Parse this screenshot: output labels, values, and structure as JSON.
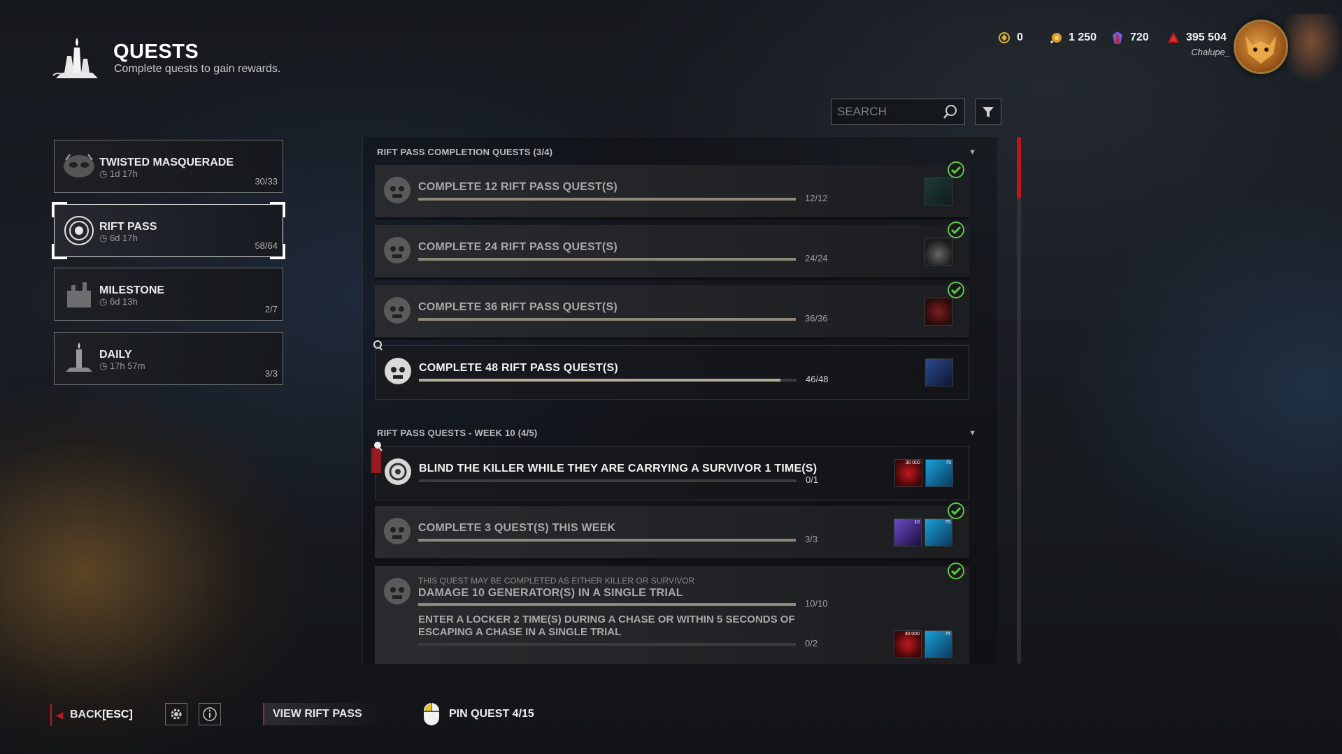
{
  "header": {
    "title": "QUESTS",
    "subtitle": "Complete quests to gain rewards."
  },
  "currencies": [
    {
      "name": "auric-cells",
      "value": "0",
      "color": "#d9b23a"
    },
    {
      "name": "iridescent-shards",
      "value": "1 250",
      "color": "#e09a2a"
    },
    {
      "name": "auric-gems",
      "value": "720",
      "color": "#7c5bd6"
    },
    {
      "name": "bloodpoints",
      "value": "395 504",
      "color": "#c1181f"
    }
  ],
  "user": {
    "name": "Chalupe_"
  },
  "search": {
    "placeholder": "SEARCH"
  },
  "categories": [
    {
      "name": "TWISTED MASQUERADE",
      "time": "1d 17h",
      "count": "30/33",
      "selected": false
    },
    {
      "name": "RIFT PASS",
      "time": "6d 17h",
      "count": "58/64",
      "selected": true
    },
    {
      "name": "MILESTONE",
      "time": "6d 13h",
      "count": "2/7",
      "selected": false
    },
    {
      "name": "DAILY",
      "time": "17h 57m",
      "count": "3/3",
      "selected": false
    }
  ],
  "sections": [
    {
      "title": "RIFT PASS COMPLETION QUESTS (3/4)",
      "quests": [
        {
          "title": "COMPLETE 12 RIFT PASS QUEST(S)",
          "progress": "12/12",
          "fill": 1.0,
          "done": true
        },
        {
          "title": "COMPLETE 24 RIFT PASS QUEST(S)",
          "progress": "24/24",
          "fill": 1.0,
          "done": true
        },
        {
          "title": "COMPLETE 36 RIFT PASS QUEST(S)",
          "progress": "36/36",
          "fill": 1.0,
          "done": true
        },
        {
          "title": "COMPLETE 48 RIFT PASS QUEST(S)",
          "progress": "46/48",
          "fill": 0.958,
          "done": false
        }
      ]
    },
    {
      "title": "RIFT PASS QUESTS - WEEK 10 (4/5)",
      "quests": [
        {
          "title": "BLIND THE KILLER WHILE THEY ARE CARRYING A SURVIVOR 1 TIME(S)",
          "progress": "0/1",
          "fill": 0.0,
          "done": false,
          "reward_labels": [
            "30 000",
            "75"
          ]
        },
        {
          "title": "COMPLETE 3 QUEST(S) THIS WEEK",
          "progress": "3/3",
          "fill": 1.0,
          "done": true,
          "reward_labels": [
            "10",
            "75"
          ]
        },
        {
          "note": "THIS QUEST MAY BE COMPLETED AS EITHER KILLER OR SURVIVOR",
          "title": "DAMAGE 10 GENERATOR(S) IN A SINGLE TRIAL",
          "progress": "10/10",
          "fill": 1.0,
          "title2": "ENTER A LOCKER 2 TIME(S) DURING A CHASE OR WITHIN 5 SECONDS OF ESCAPING A CHASE IN A SINGLE TRIAL",
          "progress2": "0/2",
          "fill2": 0.0,
          "done": true,
          "reward_labels": [
            "30 000",
            "75"
          ]
        }
      ]
    }
  ],
  "footer": {
    "back_label": "BACK",
    "back_key": "[ESC]",
    "view_rift_pass": "VIEW RIFT PASS",
    "pin_quest": "PIN QUEST 4/15"
  },
  "colors": {
    "accent_red": "#b81a1f",
    "check_green": "#5fc84a",
    "progress_fill": "#8f8778"
  }
}
